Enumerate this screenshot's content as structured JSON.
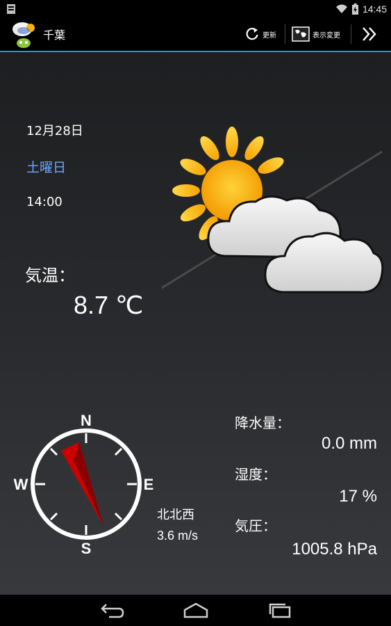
{
  "status_bar": {
    "time": "14:45",
    "icons": [
      "notification-icon",
      "wifi-icon",
      "battery-icon"
    ]
  },
  "action_bar": {
    "city": "千葉",
    "refresh_label": "更新",
    "view_label": "表示変更",
    "icons": [
      "app-logo-icon",
      "refresh-icon",
      "map-icon",
      "double-chevron-icon"
    ],
    "accent_color": "#1e9bd7"
  },
  "weather": {
    "date": "12月28日",
    "weekday": "土曜日",
    "weekday_color": "#6aa9ff",
    "time": "14:00",
    "condition_icon": "sun-behind-clouds-icon",
    "temperature_label": "気温：",
    "temperature_value": "8.7 ℃"
  },
  "wind": {
    "compass_n": "N",
    "compass_e": "E",
    "compass_s": "S",
    "compass_w": "W",
    "direction": "北北西",
    "speed": "3.6 m/s",
    "needle_color": "#cc0000"
  },
  "stats": {
    "precipitation_label": "降水量：",
    "precipitation_value": "0.0 mm",
    "humidity_label": "湿度：",
    "humidity_value": "17 %",
    "pressure_label": "気圧：",
    "pressure_value": "1005.8 hPa"
  },
  "nav": {
    "icons": [
      "back-icon",
      "home-icon",
      "recent-apps-icon"
    ]
  }
}
